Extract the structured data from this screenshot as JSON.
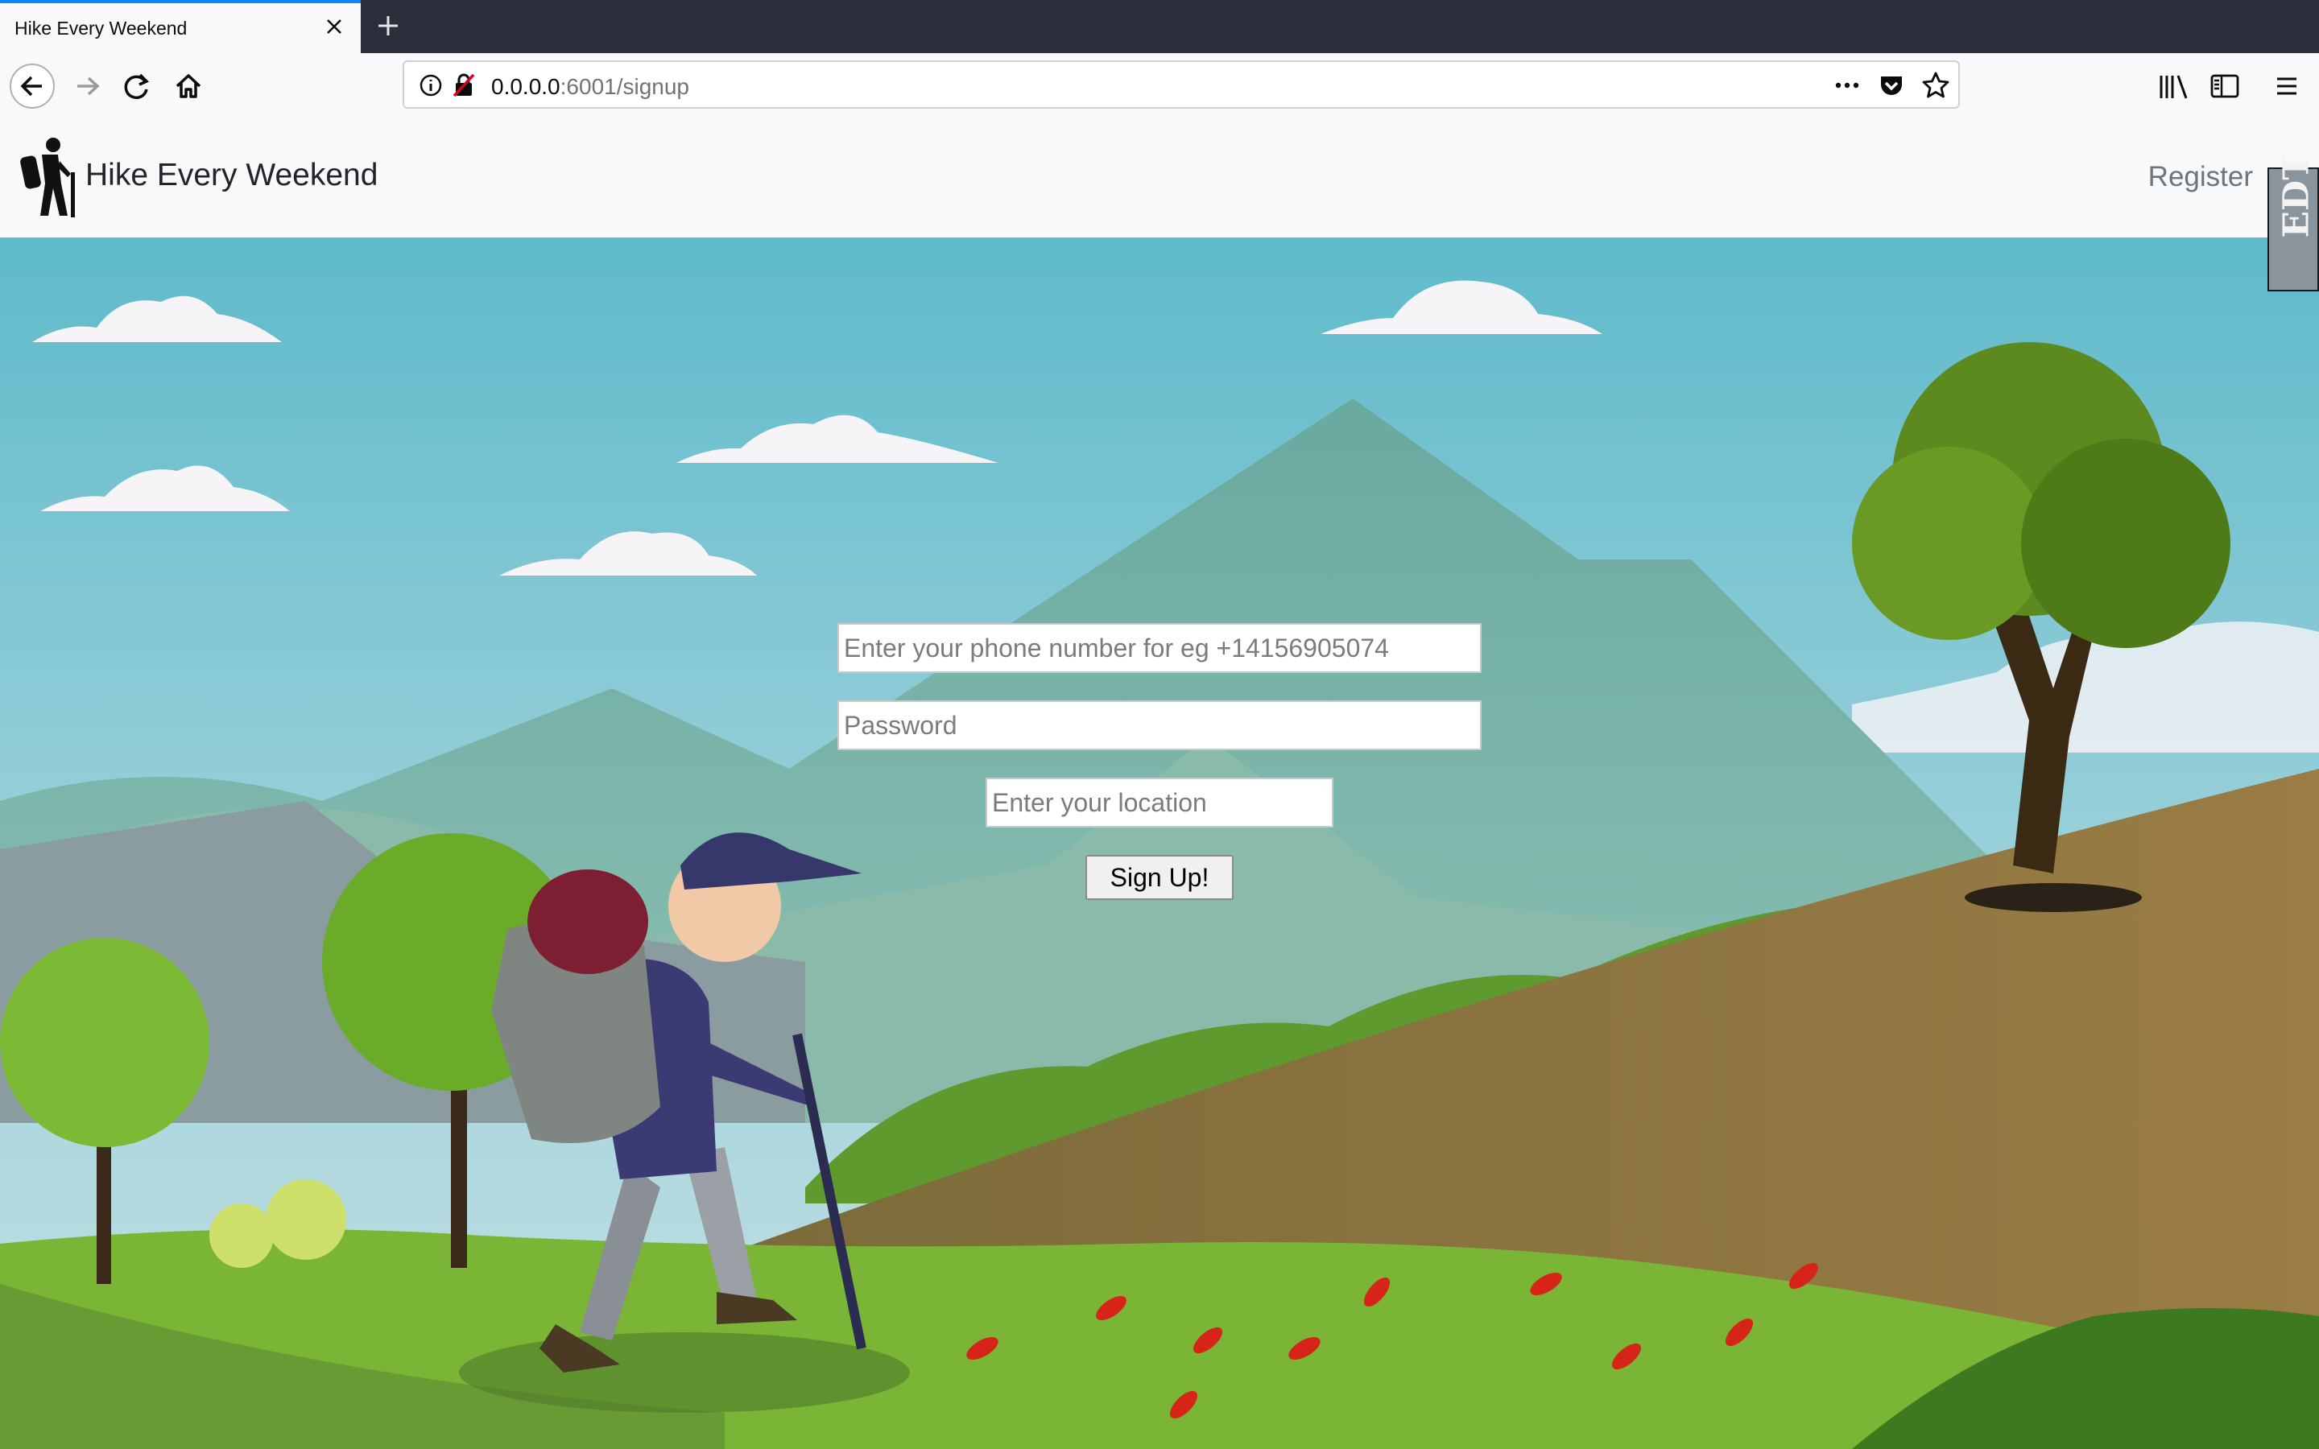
{
  "browser": {
    "tab_title": "Hike Every Weekend",
    "url_host": "0.0.0.0",
    "url_path": ":6001/signup",
    "icons": [
      "close-icon",
      "plus-icon",
      "back-arrow-icon",
      "forward-arrow-icon",
      "reload-icon",
      "home-icon",
      "info-icon",
      "insecure-lock-icon",
      "more-icon",
      "pocket-icon",
      "star-icon",
      "library-icon",
      "sidebar-icon",
      "menu-icon"
    ]
  },
  "header": {
    "brand": "Hike Every Weekend",
    "register_label": "Register"
  },
  "edt_label": "EDT",
  "form": {
    "phone_placeholder": "Enter your phone number for eg +14156905074",
    "password_placeholder": "Password",
    "location_placeholder": "Enter your location",
    "submit_label": "Sign Up!"
  },
  "colors": {
    "sky_top": "#62bccd",
    "sky_bottom": "#9fd3dc",
    "mountain": "#73b1a7",
    "grass": "#7fb735",
    "hill": "#8f7744",
    "tab_accent": "#0a84ff"
  }
}
